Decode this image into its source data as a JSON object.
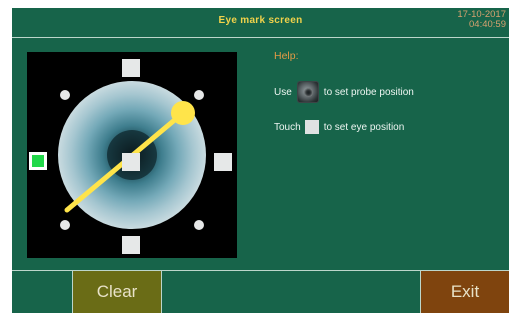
{
  "header": {
    "title": "Eye mark screen",
    "date": "17-10-2017",
    "time": "04:40:59"
  },
  "help": {
    "title": "Help:",
    "line1_prefix": "Use",
    "line1_suffix": "to set probe position",
    "line2_prefix": "Touch",
    "line2_suffix": "to set eye position",
    "probe_icon": "probe-knob-icon",
    "square_icon": "square-marker-icon"
  },
  "buttons": {
    "clear": "Clear",
    "exit": "Exit"
  },
  "eye_markers": {
    "selected": "left",
    "selected_color": "#22d84a",
    "marker_color": "#e6e8e8",
    "probe_color": "#ffe44a"
  },
  "colors": {
    "background": "#17644a",
    "title": "#f1d24a",
    "help_title": "#e39a45",
    "clear_button": "#6a6c16",
    "exit_button": "#7f440e"
  }
}
